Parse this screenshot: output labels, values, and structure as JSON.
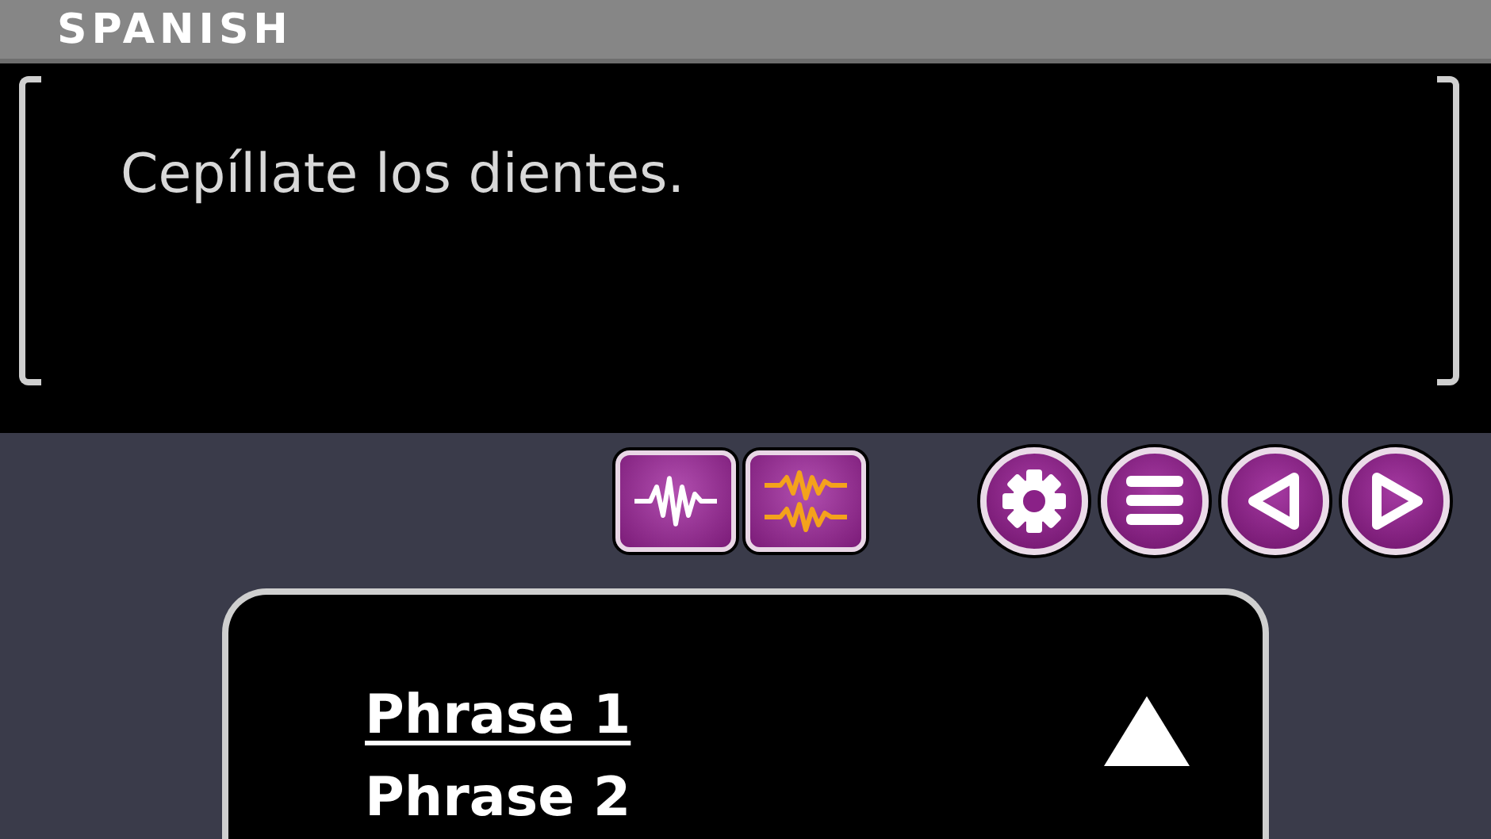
{
  "header": {
    "title": "SPANISH"
  },
  "translation": {
    "text": "Cepíllate los dientes."
  },
  "toolbar": {
    "audio_buttons": [
      {
        "kind": "single-wave"
      },
      {
        "kind": "double-wave"
      }
    ],
    "nav_buttons": [
      {
        "kind": "settings"
      },
      {
        "kind": "menu"
      },
      {
        "kind": "previous"
      },
      {
        "kind": "next"
      }
    ]
  },
  "phrase_list": {
    "items": [
      {
        "label": "Phrase 1",
        "selected": true
      },
      {
        "label": "Phrase 2",
        "selected": false
      }
    ]
  }
}
